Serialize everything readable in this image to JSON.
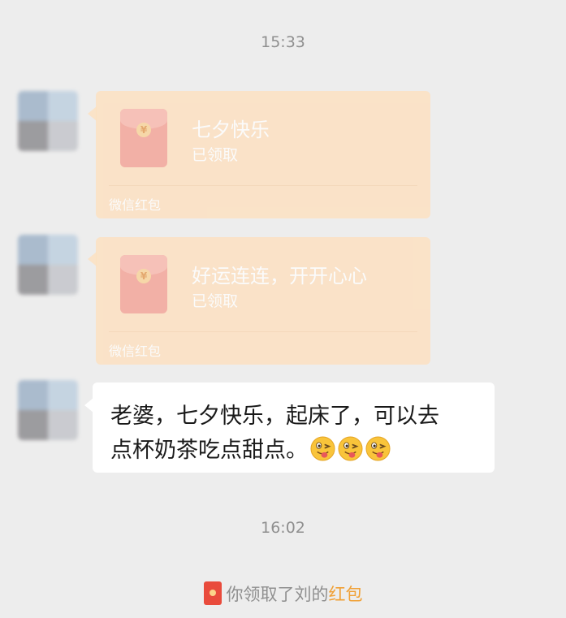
{
  "timestamps": [
    "15:33",
    "16:02"
  ],
  "red_packets": [
    {
      "greeting": "七夕快乐",
      "status": "已领取",
      "brand": "微信红包",
      "currency_icon": "yuan-coin-icon"
    },
    {
      "greeting": "好运连连，开开心心",
      "status": "已领取",
      "brand": "微信红包",
      "currency_icon": "yuan-coin-icon"
    }
  ],
  "text_message": {
    "line1": "老婆，七夕快乐，起床了，可以去",
    "line2": "点杯奶茶吃点甜点。",
    "emoji_count": 3,
    "emoji_name": "winking-tongue-out-emoji-icon"
  },
  "system_note": {
    "prefix": "你领取了刘的",
    "link": "红包",
    "icon": "red-packet-icon"
  },
  "colors": {
    "background": "#ededed",
    "red_packet_card": "#fde0c0",
    "envelope": "#f4a397",
    "bubble": "#ffffff",
    "link": "#f0a035"
  }
}
